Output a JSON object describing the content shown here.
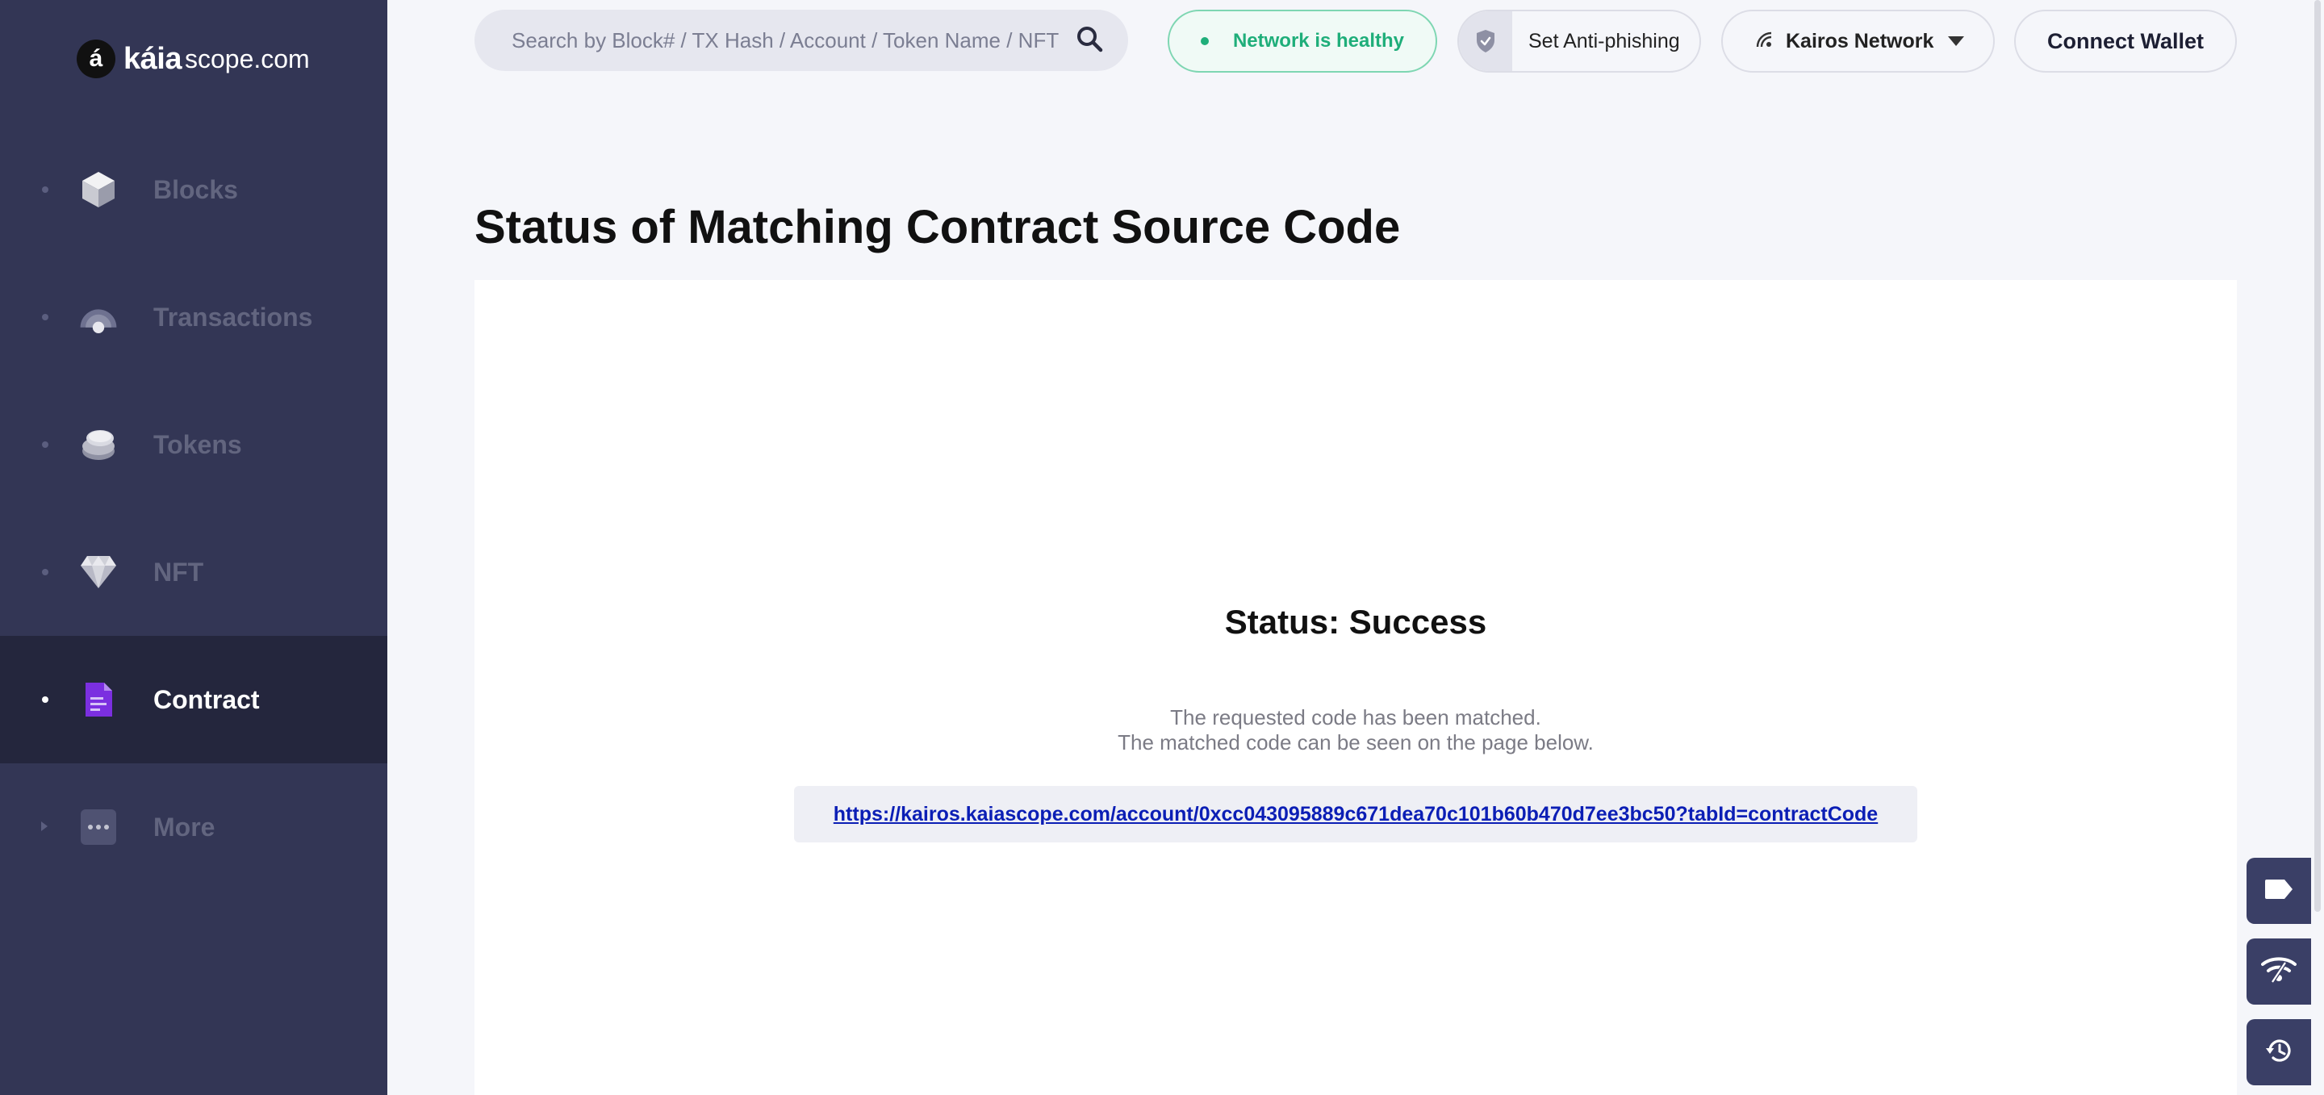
{
  "sidebar": {
    "logo": {
      "mark": "á",
      "brand": "káia",
      "domain": "scope.com"
    },
    "items": [
      {
        "label": "Blocks",
        "icon": "cube-icon"
      },
      {
        "label": "Transactions",
        "icon": "transactions-icon"
      },
      {
        "label": "Tokens",
        "icon": "coins-icon"
      },
      {
        "label": "NFT",
        "icon": "diamond-icon"
      },
      {
        "label": "Contract",
        "icon": "document-icon",
        "active": true
      },
      {
        "label": "More",
        "icon": "more-icon"
      }
    ]
  },
  "header": {
    "search": {
      "placeholder": "Search by Block# / TX Hash / Account / Token Name / NFT"
    },
    "network_status": "Network is healthy",
    "anti_phishing": "Set Anti-phishing",
    "network_selector": "Kairos Network",
    "connect_wallet": "Connect Wallet"
  },
  "main": {
    "title": "Status of Matching Contract Source Code",
    "status_title": "Status: Success",
    "status_line1": "The requested code has been matched.",
    "status_line2": "The matched code can be seen on the page below.",
    "link": "https://kairos.kaiascope.com/account/0xcc043095889c671dea70c101b60b470d7ee3bc50?tabId=contractCode"
  },
  "colors": {
    "sidebar_bg": "#333655",
    "sidebar_active": "#24263d",
    "healthy_green": "#1fae7a",
    "link_blue": "#0b1eb5",
    "contract_purple": "#7b2fe0"
  },
  "floating_buttons": [
    "tag-icon",
    "network-signal-icon",
    "history-icon"
  ]
}
